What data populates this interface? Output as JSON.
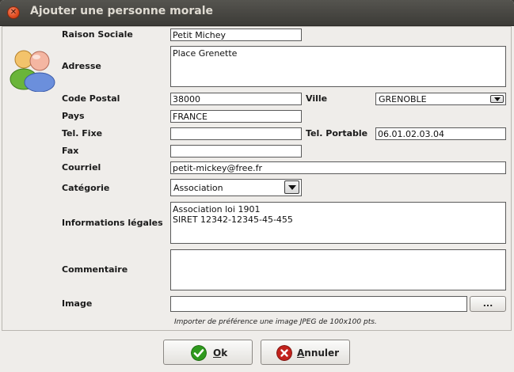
{
  "window": {
    "title": "Ajouter une personne morale"
  },
  "labels": {
    "raison_sociale": "Raison Sociale",
    "adresse": "Adresse",
    "code_postal": "Code Postal",
    "ville": "Ville",
    "pays": "Pays",
    "tel_fixe": "Tel. Fixe",
    "tel_portable": "Tel. Portable",
    "fax": "Fax",
    "courriel": "Courriel",
    "categorie": "Catégorie",
    "informations_legales": "Informations légales",
    "commentaire": "Commentaire",
    "image": "Image"
  },
  "values": {
    "raison_sociale": "Petit Michey",
    "adresse": "Place Grenette",
    "code_postal": "38000",
    "ville": "GRENOBLE",
    "pays": "FRANCE",
    "tel_fixe": "",
    "tel_portable": "06.01.02.03.04",
    "fax": "",
    "courriel": "petit-mickey@free.fr",
    "categorie": "Association",
    "informations_legales": "Association loi 1901\nSIRET 12342-12345-45-455",
    "commentaire": "",
    "image": ""
  },
  "browse_button_label": "...",
  "image_hint": "Importer de préférence une image JPEG de 100x100 pts.",
  "buttons": {
    "ok_underlined": "O",
    "ok_rest": "k",
    "cancel_underlined": "A",
    "cancel_rest": "nnuler"
  },
  "colors": {
    "ok_icon": "#2f9a1e",
    "cancel_icon": "#c2221c",
    "titlebar": "#3c3b37"
  }
}
